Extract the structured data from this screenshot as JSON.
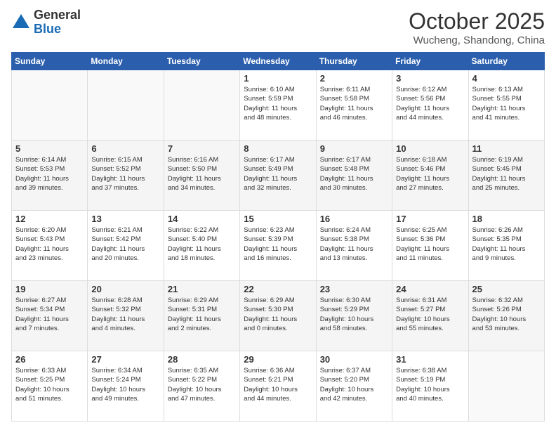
{
  "header": {
    "logo_general": "General",
    "logo_blue": "Blue",
    "month_title": "October 2025",
    "location": "Wucheng, Shandong, China"
  },
  "weekdays": [
    "Sunday",
    "Monday",
    "Tuesday",
    "Wednesday",
    "Thursday",
    "Friday",
    "Saturday"
  ],
  "weeks": [
    [
      {
        "day": "",
        "info": ""
      },
      {
        "day": "",
        "info": ""
      },
      {
        "day": "",
        "info": ""
      },
      {
        "day": "1",
        "info": "Sunrise: 6:10 AM\nSunset: 5:59 PM\nDaylight: 11 hours\nand 48 minutes."
      },
      {
        "day": "2",
        "info": "Sunrise: 6:11 AM\nSunset: 5:58 PM\nDaylight: 11 hours\nand 46 minutes."
      },
      {
        "day": "3",
        "info": "Sunrise: 6:12 AM\nSunset: 5:56 PM\nDaylight: 11 hours\nand 44 minutes."
      },
      {
        "day": "4",
        "info": "Sunrise: 6:13 AM\nSunset: 5:55 PM\nDaylight: 11 hours\nand 41 minutes."
      }
    ],
    [
      {
        "day": "5",
        "info": "Sunrise: 6:14 AM\nSunset: 5:53 PM\nDaylight: 11 hours\nand 39 minutes."
      },
      {
        "day": "6",
        "info": "Sunrise: 6:15 AM\nSunset: 5:52 PM\nDaylight: 11 hours\nand 37 minutes."
      },
      {
        "day": "7",
        "info": "Sunrise: 6:16 AM\nSunset: 5:50 PM\nDaylight: 11 hours\nand 34 minutes."
      },
      {
        "day": "8",
        "info": "Sunrise: 6:17 AM\nSunset: 5:49 PM\nDaylight: 11 hours\nand 32 minutes."
      },
      {
        "day": "9",
        "info": "Sunrise: 6:17 AM\nSunset: 5:48 PM\nDaylight: 11 hours\nand 30 minutes."
      },
      {
        "day": "10",
        "info": "Sunrise: 6:18 AM\nSunset: 5:46 PM\nDaylight: 11 hours\nand 27 minutes."
      },
      {
        "day": "11",
        "info": "Sunrise: 6:19 AM\nSunset: 5:45 PM\nDaylight: 11 hours\nand 25 minutes."
      }
    ],
    [
      {
        "day": "12",
        "info": "Sunrise: 6:20 AM\nSunset: 5:43 PM\nDaylight: 11 hours\nand 23 minutes."
      },
      {
        "day": "13",
        "info": "Sunrise: 6:21 AM\nSunset: 5:42 PM\nDaylight: 11 hours\nand 20 minutes."
      },
      {
        "day": "14",
        "info": "Sunrise: 6:22 AM\nSunset: 5:40 PM\nDaylight: 11 hours\nand 18 minutes."
      },
      {
        "day": "15",
        "info": "Sunrise: 6:23 AM\nSunset: 5:39 PM\nDaylight: 11 hours\nand 16 minutes."
      },
      {
        "day": "16",
        "info": "Sunrise: 6:24 AM\nSunset: 5:38 PM\nDaylight: 11 hours\nand 13 minutes."
      },
      {
        "day": "17",
        "info": "Sunrise: 6:25 AM\nSunset: 5:36 PM\nDaylight: 11 hours\nand 11 minutes."
      },
      {
        "day": "18",
        "info": "Sunrise: 6:26 AM\nSunset: 5:35 PM\nDaylight: 11 hours\nand 9 minutes."
      }
    ],
    [
      {
        "day": "19",
        "info": "Sunrise: 6:27 AM\nSunset: 5:34 PM\nDaylight: 11 hours\nand 7 minutes."
      },
      {
        "day": "20",
        "info": "Sunrise: 6:28 AM\nSunset: 5:32 PM\nDaylight: 11 hours\nand 4 minutes."
      },
      {
        "day": "21",
        "info": "Sunrise: 6:29 AM\nSunset: 5:31 PM\nDaylight: 11 hours\nand 2 minutes."
      },
      {
        "day": "22",
        "info": "Sunrise: 6:29 AM\nSunset: 5:30 PM\nDaylight: 11 hours\nand 0 minutes."
      },
      {
        "day": "23",
        "info": "Sunrise: 6:30 AM\nSunset: 5:29 PM\nDaylight: 10 hours\nand 58 minutes."
      },
      {
        "day": "24",
        "info": "Sunrise: 6:31 AM\nSunset: 5:27 PM\nDaylight: 10 hours\nand 55 minutes."
      },
      {
        "day": "25",
        "info": "Sunrise: 6:32 AM\nSunset: 5:26 PM\nDaylight: 10 hours\nand 53 minutes."
      }
    ],
    [
      {
        "day": "26",
        "info": "Sunrise: 6:33 AM\nSunset: 5:25 PM\nDaylight: 10 hours\nand 51 minutes."
      },
      {
        "day": "27",
        "info": "Sunrise: 6:34 AM\nSunset: 5:24 PM\nDaylight: 10 hours\nand 49 minutes."
      },
      {
        "day": "28",
        "info": "Sunrise: 6:35 AM\nSunset: 5:22 PM\nDaylight: 10 hours\nand 47 minutes."
      },
      {
        "day": "29",
        "info": "Sunrise: 6:36 AM\nSunset: 5:21 PM\nDaylight: 10 hours\nand 44 minutes."
      },
      {
        "day": "30",
        "info": "Sunrise: 6:37 AM\nSunset: 5:20 PM\nDaylight: 10 hours\nand 42 minutes."
      },
      {
        "day": "31",
        "info": "Sunrise: 6:38 AM\nSunset: 5:19 PM\nDaylight: 10 hours\nand 40 minutes."
      },
      {
        "day": "",
        "info": ""
      }
    ]
  ]
}
